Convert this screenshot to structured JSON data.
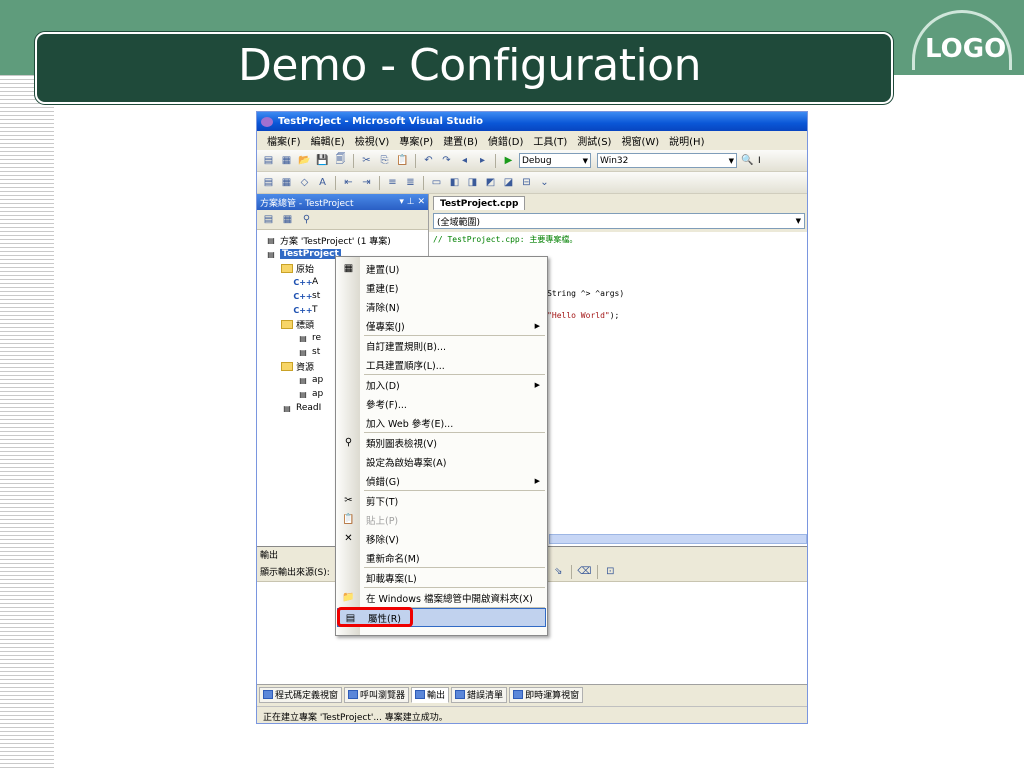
{
  "slide": {
    "title": "Demo - Configuration",
    "logo": "LOGO",
    "colors": {
      "banner": "#5f9c7c",
      "title_box": "#1f4a3a"
    }
  },
  "window": {
    "title": "TestProject - Microsoft Visual Studio",
    "menu": [
      "檔案(F)",
      "編輯(E)",
      "檢視(V)",
      "專案(P)",
      "建置(B)",
      "偵錯(D)",
      "工具(T)",
      "測試(S)",
      "視窗(W)",
      "說明(H)"
    ],
    "config_combo": "Debug",
    "platform_combo": "Win32",
    "toolbar_trailing": "I"
  },
  "solution_explorer": {
    "title": "方案總管 - TestProject",
    "title_controls": "▾ ⊥ ✕",
    "items": [
      {
        "label": "方案 'TestProject' (1 專案)"
      },
      {
        "label": "TestProject",
        "selected": true
      },
      {
        "label": "原始"
      },
      {
        "label": "A"
      },
      {
        "label": "st"
      },
      {
        "label": "T"
      },
      {
        "label": "標頭"
      },
      {
        "label": "re"
      },
      {
        "label": "st"
      },
      {
        "label": "資源"
      },
      {
        "label": "ap"
      },
      {
        "label": "ap"
      },
      {
        "label": "ReadI"
      }
    ]
  },
  "editor": {
    "tab": "TestProject.cpp",
    "scope": "(全域範圍)",
    "code": [
      {
        "text": "// TestProject.cpp: 主要專案檔。",
        "kind": "comment"
      },
      {
        "text": "",
        "kind": "plain"
      },
      {
        "text": "",
        "kind": "plain"
      },
      {
        "text": "tem;",
        "kind": "plain"
      },
      {
        "text": "",
        "kind": "plain"
      },
      {
        "text": "tem::String ^> ^args)",
        "kind": "plain"
      },
      {
        "text": "",
        "kind": "plain"
      },
      {
        "text": "ine(L\"Hello World\");",
        "kind": "mixed"
      }
    ]
  },
  "context_menu": {
    "items": [
      {
        "label": "建置(U)",
        "icon": "build-icon"
      },
      {
        "label": "重建(E)"
      },
      {
        "label": "清除(N)"
      },
      {
        "label": "僅專案(J)",
        "submenu": true
      },
      {
        "sep": true
      },
      {
        "label": "自訂建置規則(B)..."
      },
      {
        "label": "工具建置順序(L)..."
      },
      {
        "sep": true
      },
      {
        "label": "加入(D)",
        "submenu": true
      },
      {
        "label": "參考(F)..."
      },
      {
        "label": "加入 Web 參考(E)..."
      },
      {
        "sep": true
      },
      {
        "label": "類別圖表檢視(V)",
        "icon": "class-diagram-icon"
      },
      {
        "label": "設定為啟始專案(A)"
      },
      {
        "label": "偵錯(G)",
        "submenu": true
      },
      {
        "sep": true
      },
      {
        "label": "剪下(T)",
        "icon": "cut-icon"
      },
      {
        "label": "貼上(P)",
        "icon": "paste-icon",
        "disabled": true
      },
      {
        "label": "移除(V)",
        "icon": "remove-icon"
      },
      {
        "label": "重新命名(M)"
      },
      {
        "sep": true
      },
      {
        "label": "卸載專案(L)"
      },
      {
        "sep": true
      },
      {
        "label": "在 Windows 檔案總管中開啟資料夾(X)",
        "icon": "open-folder-icon"
      },
      {
        "sep": true
      },
      {
        "label": "屬性(R)",
        "icon": "properties-icon",
        "highlight": true
      }
    ]
  },
  "output": {
    "title": "輸出",
    "source_label": "顯示輸出來源(S):"
  },
  "bottom_tabs": [
    "程式碼定義視窗",
    "呼叫瀏覽器",
    "輸出",
    "錯誤清單",
    "即時運算視窗"
  ],
  "status": "正在建立專案 'TestProject'... 專案建立成功。"
}
